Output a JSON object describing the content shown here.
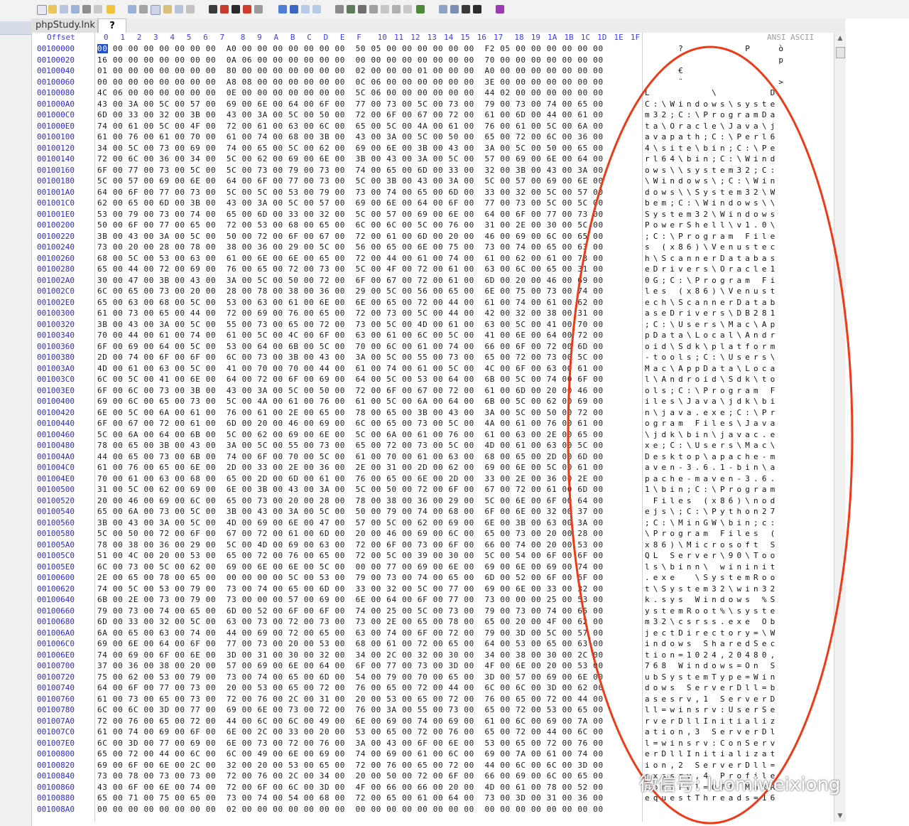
{
  "tabs": [
    "phpStudy.lnk",
    "?"
  ],
  "header": {
    "offset_label": "Offset",
    "columns": [
      "0",
      "1",
      "2",
      "3",
      "4",
      "5",
      "6",
      "7",
      "8",
      "9",
      "A",
      "B",
      "C",
      "D",
      "E",
      "F",
      "10",
      "11",
      "12",
      "13",
      "14",
      "15",
      "16",
      "17",
      "18",
      "19",
      "1A",
      "1B",
      "1C",
      "1D",
      "1E",
      "1F"
    ],
    "ascii_label": "ANSI ASCII"
  },
  "rows": [
    {
      "offset": "00100000",
      "hex": "00 00 00 00 00 00 00 00  A0 00 00 00 00 00 00 00  50 05 00 00 00 00 00 00  F2 05 00 00 00 00 00 00",
      "ascii": "    ?       P   ò   "
    },
    {
      "offset": "00100020",
      "hex": "16 00 00 00 00 00 00 00  0A 06 00 00 00 00 00 00  00 00 00 00 00 00 00 00  70 00 00 00 00 00 00 00",
      "ascii": "                p   "
    },
    {
      "offset": "00100040",
      "hex": "01 00 00 00 00 00 00 00  80 00 00 00 00 00 00 00  02 00 00 00 01 00 00 00  A0 00 00 00 00 00 00 00",
      "ascii": "    €               "
    },
    {
      "offset": "00100060",
      "hex": "00 00 00 00 00 00 00 00  A8 08 00 00 00 00 00 00  0C 06 00 00 00 00 00 00  3E 00 00 00 00 00 00 00",
      "ascii": "    ¨           >   "
    },
    {
      "offset": "00100080",
      "hex": "4C 06 00 00 00 00 00 00  0E 00 00 00 00 00 00 00  5C 06 00 00 00 00 00 00  44 02 00 00 00 00 00 00",
      "ascii": "L       \\      D    "
    },
    {
      "offset": "001000A0",
      "hex": "43 00 3A 00 5C 00 57 00  69 00 6E 00 64 00 6F 00  77 00 73 00 5C 00 73 00  79 00 73 00 74 00 65 00",
      "ascii": "C:\\Windows\\syste"
    },
    {
      "offset": "001000C0",
      "hex": "6D 00 33 00 32 00 3B 00  43 00 3A 00 5C 00 50 00  72 00 6F 00 67 00 72 00  61 00 6D 00 44 00 61 00",
      "ascii": "m32;C:\\ProgramDa"
    },
    {
      "offset": "001000E0",
      "hex": "74 00 61 00 5C 00 4F 00  72 00 61 00 63 00 6C 00  65 00 5C 00 4A 00 61 00  76 00 61 00 5C 00 6A 00",
      "ascii": "ta\\Oracle\\Java\\j"
    },
    {
      "offset": "00100100",
      "hex": "61 00 76 00 61 00 70 00  61 00 74 00 68 00 3B 00  43 00 3A 00 5C 00 50 00  65 00 72 00 6C 00 36 00",
      "ascii": "avapath;C:\\Perl6"
    },
    {
      "offset": "00100120",
      "hex": "34 00 5C 00 73 00 69 00  74 00 65 00 5C 00 62 00  69 00 6E 00 3B 00 43 00  3A 00 5C 00 50 00 65 00",
      "ascii": "4\\site\\bin;C:\\Pe"
    },
    {
      "offset": "00100140",
      "hex": "72 00 6C 00 36 00 34 00  5C 00 62 00 69 00 6E 00  3B 00 43 00 3A 00 5C 00  57 00 69 00 6E 00 64 00",
      "ascii": "rl64\\bin;C:\\Wind"
    },
    {
      "offset": "00100160",
      "hex": "6F 00 77 00 73 00 5C 00  5C 00 73 00 79 00 73 00  74 00 65 00 6D 00 33 00  32 00 3B 00 43 00 3A 00",
      "ascii": "ows\\\\system32;C:"
    },
    {
      "offset": "00100180",
      "hex": "5C 00 57 00 69 00 6E 00  64 00 6F 00 77 00 73 00  5C 00 3B 00 43 00 3A 00  5C 00 57 00 69 00 6E 00",
      "ascii": "\\Windows\\;C:\\Win"
    },
    {
      "offset": "001001A0",
      "hex": "64 00 6F 00 77 00 73 00  5C 00 5C 00 53 00 79 00  73 00 74 00 65 00 6D 00  33 00 32 00 5C 00 57 00",
      "ascii": "dows\\\\System32\\W"
    },
    {
      "offset": "001001C0",
      "hex": "62 00 65 00 6D 00 3B 00  43 00 3A 00 5C 00 57 00  69 00 6E 00 64 00 6F 00  77 00 73 00 5C 00 5C 00",
      "ascii": "bem;C:\\Windows\\\\"
    },
    {
      "offset": "001001E0",
      "hex": "53 00 79 00 73 00 74 00  65 00 6D 00 33 00 32 00  5C 00 57 00 69 00 6E 00  64 00 6F 00 77 00 73 00",
      "ascii": "System32\\Windows"
    },
    {
      "offset": "00100200",
      "hex": "50 00 6F 00 77 00 65 00  72 00 53 00 68 00 65 00  6C 00 6C 00 5C 00 76 00  31 00 2E 00 30 00 5C 00",
      "ascii": "PowerShell\\v1.0\\"
    },
    {
      "offset": "00100220",
      "hex": "3B 00 43 00 3A 00 5C 00  50 00 72 00 6F 00 67 00  72 00 61 00 6D 00 20 00  46 00 69 00 6C 00 65 00",
      "ascii": ";C:\\Program File"
    },
    {
      "offset": "00100240",
      "hex": "73 00 20 00 28 00 78 00  38 00 36 00 29 00 5C 00  56 00 65 00 6E 00 75 00  73 00 74 00 65 00 63 00",
      "ascii": "s (x86)\\Venustec"
    },
    {
      "offset": "00100260",
      "hex": "68 00 5C 00 53 00 63 00  61 00 6E 00 6E 00 65 00  72 00 44 00 61 00 74 00  61 00 62 00 61 00 73 00",
      "ascii": "h\\ScannerDatabas"
    },
    {
      "offset": "00100280",
      "hex": "65 00 44 00 72 00 69 00  76 00 65 00 72 00 73 00  5C 00 4F 00 72 00 61 00  63 00 6C 00 65 00 31 00",
      "ascii": "eDrivers\\Oracle1"
    },
    {
      "offset": "001002A0",
      "hex": "30 00 47 00 3B 00 43 00  3A 00 5C 00 50 00 72 00  6F 00 67 00 72 00 61 00  6D 00 20 00 46 00 69 00",
      "ascii": "0G;C:\\Program Fi"
    },
    {
      "offset": "001002C0",
      "hex": "6C 00 65 00 73 00 20 00  28 00 78 00 38 00 36 00  29 00 5C 00 56 00 65 00  6E 00 75 00 73 00 74 00",
      "ascii": "les (x86)\\Venust"
    },
    {
      "offset": "001002E0",
      "hex": "65 00 63 00 68 00 5C 00  53 00 63 00 61 00 6E 00  6E 00 65 00 72 00 44 00  61 00 74 00 61 00 62 00",
      "ascii": "ech\\ScannerDatab"
    },
    {
      "offset": "00100300",
      "hex": "61 00 73 00 65 00 44 00  72 00 69 00 76 00 65 00  72 00 73 00 5C 00 44 00  42 00 32 00 38 00 31 00",
      "ascii": "aseDrivers\\DB281"
    },
    {
      "offset": "00100320",
      "hex": "3B 00 43 00 3A 00 5C 00  55 00 73 00 65 00 72 00  73 00 5C 00 4D 00 61 00  63 00 5C 00 41 00 70 00",
      "ascii": ";C:\\Users\\Mac\\Ap"
    },
    {
      "offset": "00100340",
      "hex": "70 00 44 00 61 00 74 00  61 00 5C 00 4C 00 6F 00  63 00 61 00 6C 00 5C 00  41 00 6E 00 64 00 72 00",
      "ascii": "pData\\Local\\Andr"
    },
    {
      "offset": "00100360",
      "hex": "6F 00 69 00 64 00 5C 00  53 00 64 00 6B 00 5C 00  70 00 6C 00 61 00 74 00  66 00 6F 00 72 00 6D 00",
      "ascii": "oid\\Sdk\\platform"
    },
    {
      "offset": "00100380",
      "hex": "2D 00 74 00 6F 00 6F 00  6C 00 73 00 3B 00 43 00  3A 00 5C 00 55 00 73 00  65 00 72 00 73 00 5C 00",
      "ascii": "-tools;C:\\Users\\"
    },
    {
      "offset": "001003A0",
      "hex": "4D 00 61 00 63 00 5C 00  41 00 70 00 70 00 44 00  61 00 74 00 61 00 5C 00  4C 00 6F 00 63 00 61 00",
      "ascii": "Mac\\AppData\\Loca"
    },
    {
      "offset": "001003C0",
      "hex": "6C 00 5C 00 41 00 6E 00  64 00 72 00 6F 00 69 00  64 00 5C 00 53 00 64 00  6B 00 5C 00 74 00 6F 00",
      "ascii": "l\\Android\\Sdk\\to"
    },
    {
      "offset": "001003E0",
      "hex": "6F 00 6C 00 73 00 3B 00  43 00 3A 00 5C 00 50 00  72 00 6F 00 67 00 72 00  61 00 6D 00 20 00 46 00",
      "ascii": "ols;C:\\Program F"
    },
    {
      "offset": "00100400",
      "hex": "69 00 6C 00 65 00 73 00  5C 00 4A 00 61 00 76 00  61 00 5C 00 6A 00 64 00  6B 00 5C 00 62 00 69 00",
      "ascii": "iles\\Java\\jdk\\bi"
    },
    {
      "offset": "00100420",
      "hex": "6E 00 5C 00 6A 00 61 00  76 00 61 00 2E 00 65 00  78 00 65 00 3B 00 43 00  3A 00 5C 00 50 00 72 00",
      "ascii": "n\\java.exe;C:\\Pr"
    },
    {
      "offset": "00100440",
      "hex": "6F 00 67 00 72 00 61 00  6D 00 20 00 46 00 69 00  6C 00 65 00 73 00 5C 00  4A 00 61 00 76 00 61 00",
      "ascii": "ogram Files\\Java"
    },
    {
      "offset": "00100460",
      "hex": "5C 00 6A 00 64 00 6B 00  5C 00 62 00 69 00 6E 00  5C 00 6A 00 61 00 76 00  61 00 63 00 2E 00 65 00",
      "ascii": "\\jdk\\bin\\javac.e"
    },
    {
      "offset": "00100480",
      "hex": "78 00 65 00 3B 00 43 00  3A 00 5C 00 55 00 73 00  65 00 72 00 73 00 5C 00  4D 00 61 00 63 00 5C 00",
      "ascii": "xe;C:\\Users\\Mac\\"
    },
    {
      "offset": "001004A0",
      "hex": "44 00 65 00 73 00 6B 00  74 00 6F 00 70 00 5C 00  61 00 70 00 61 00 63 00  68 00 65 00 2D 00 6D 00",
      "ascii": "Desktop\\apache-m"
    },
    {
      "offset": "001004C0",
      "hex": "61 00 76 00 65 00 6E 00  2D 00 33 00 2E 00 36 00  2E 00 31 00 2D 00 62 00  69 00 6E 00 5C 00 61 00",
      "ascii": "aven-3.6.1-bin\\a"
    },
    {
      "offset": "001004E0",
      "hex": "70 00 61 00 63 00 68 00  65 00 2D 00 6D 00 61 00  76 00 65 00 6E 00 2D 00  33 00 2E 00 36 00 2E 00",
      "ascii": "pache-maven-3.6."
    },
    {
      "offset": "00100500",
      "hex": "31 00 5C 00 62 00 69 00  6E 00 3B 00 43 00 3A 00  5C 00 50 00 72 00 6F 00  67 00 72 00 61 00 6D 00",
      "ascii": "1\\bin;C:\\Program"
    },
    {
      "offset": "00100520",
      "hex": "20 00 46 00 69 00 6C 00  65 00 73 00 20 00 28 00  78 00 38 00 36 00 29 00  5C 00 6E 00 6F 00 64 00",
      "ascii": " Files (x86)\\nod"
    },
    {
      "offset": "00100540",
      "hex": "65 00 6A 00 73 00 5C 00  3B 00 43 00 3A 00 5C 00  50 00 79 00 74 00 68 00  6F 00 6E 00 32 00 37 00",
      "ascii": "ejs\\;C:\\Python27"
    },
    {
      "offset": "00100560",
      "hex": "3B 00 43 00 3A 00 5C 00  4D 00 69 00 6E 00 47 00  57 00 5C 00 62 00 69 00  6E 00 3B 00 63 00 3A 00",
      "ascii": ";C:\\MinGW\\bin;c:"
    },
    {
      "offset": "00100580",
      "hex": "5C 00 50 00 72 00 6F 00  67 00 72 00 61 00 6D 00  20 00 46 00 69 00 6C 00  65 00 73 00 20 00 28 00",
      "ascii": "\\Program Files ("
    },
    {
      "offset": "001005A0",
      "hex": "78 00 38 00 36 00 29 00  5C 00 4D 00 69 00 63 00  72 00 6F 00 73 00 6F 00  66 00 74 00 20 00 53 00",
      "ascii": "x86)\\Microsoft S"
    },
    {
      "offset": "001005C0",
      "hex": "51 00 4C 00 20 00 53 00  65 00 72 00 76 00 65 00  72 00 5C 00 39 00 30 00  5C 00 54 00 6F 00 6F 00",
      "ascii": "QL Server\\90\\Too"
    },
    {
      "offset": "001005E0",
      "hex": "6C 00 73 00 5C 00 62 00  69 00 6E 00 6E 00 5C 00  00 00 77 00 69 00 6E 00  69 00 6E 00 69 00 74 00",
      "ascii": "ls\\binn\\ wininit"
    },
    {
      "offset": "00100600",
      "hex": "2E 00 65 00 78 00 65 00  00 00 00 00 5C 00 53 00  79 00 73 00 74 00 65 00  6D 00 52 00 6F 00 6F 00",
      "ascii": ".exe  \\SystemRoo"
    },
    {
      "offset": "00100620",
      "hex": "74 00 5C 00 53 00 79 00  73 00 74 00 65 00 6D 00  33 00 32 00 5C 00 77 00  69 00 6E 00 33 00 32 00",
      "ascii": "t\\System32\\win32"
    },
    {
      "offset": "00100640",
      "hex": "6B 00 2E 00 73 00 79 00  73 00 00 00 57 00 69 00  6E 00 64 00 6F 00 77 00  73 00 00 00 25 00 53 00",
      "ascii": "k.sys Windows %S"
    },
    {
      "offset": "00100660",
      "hex": "79 00 73 00 74 00 65 00  6D 00 52 00 6F 00 6F 00  74 00 25 00 5C 00 73 00  79 00 73 00 74 00 65 00",
      "ascii": "ystemRoot%\\syste"
    },
    {
      "offset": "00100680",
      "hex": "6D 00 33 00 32 00 5C 00  63 00 73 00 72 00 73 00  73 00 2E 00 65 00 78 00  65 00 20 00 4F 00 62 00",
      "ascii": "m32\\csrss.exe Ob"
    },
    {
      "offset": "001006A0",
      "hex": "6A 00 65 00 63 00 74 00  44 00 69 00 72 00 65 00  63 00 74 00 6F 00 72 00  79 00 3D 00 5C 00 57 00",
      "ascii": "jectDirectory=\\W"
    },
    {
      "offset": "001006C0",
      "hex": "69 00 6E 00 64 00 6F 00  77 00 73 00 20 00 53 00  68 00 61 00 72 00 65 00  64 00 53 00 65 00 63 00",
      "ascii": "indows SharedSec"
    },
    {
      "offset": "001006E0",
      "hex": "74 00 69 00 6F 00 6E 00  3D 00 31 00 30 00 32 00  34 00 2C 00 32 00 30 00  34 00 38 00 30 00 2C 00",
      "ascii": "tion=1024,20480,"
    },
    {
      "offset": "00100700",
      "hex": "37 00 36 00 38 00 20 00  57 00 69 00 6E 00 64 00  6F 00 77 00 73 00 3D 00  4F 00 6E 00 20 00 53 00",
      "ascii": "768 Windows=On S"
    },
    {
      "offset": "00100720",
      "hex": "75 00 62 00 53 00 79 00  73 00 74 00 65 00 6D 00  54 00 79 00 70 00 65 00  3D 00 57 00 69 00 6E 00",
      "ascii": "ubSystemType=Win"
    },
    {
      "offset": "00100740",
      "hex": "64 00 6F 00 77 00 73 00  20 00 53 00 65 00 72 00  76 00 65 00 72 00 44 00  6C 00 6C 00 3D 00 62 00",
      "ascii": "dows ServerDll=b"
    },
    {
      "offset": "00100760",
      "hex": "61 00 73 00 65 00 73 00  72 00 76 00 2C 00 31 00  20 00 53 00 65 00 72 00  76 00 65 00 72 00 44 00",
      "ascii": "asesrv,1 ServerD"
    },
    {
      "offset": "00100780",
      "hex": "6C 00 6C 00 3D 00 77 00  69 00 6E 00 73 00 72 00  76 00 3A 00 55 00 73 00  65 00 72 00 53 00 65 00",
      "ascii": "ll=winsrv:UserSe"
    },
    {
      "offset": "001007A0",
      "hex": "72 00 76 00 65 00 72 00  44 00 6C 00 6C 00 49 00  6E 00 69 00 74 00 69 00  61 00 6C 00 69 00 7A 00",
      "ascii": "rverDllInitializ"
    },
    {
      "offset": "001007C0",
      "hex": "61 00 74 00 69 00 6F 00  6E 00 2C 00 33 00 20 00  53 00 65 00 72 00 76 00  65 00 72 00 44 00 6C 00",
      "ascii": "ation,3 ServerDl"
    },
    {
      "offset": "001007E0",
      "hex": "6C 00 3D 00 77 00 69 00  6E 00 73 00 72 00 76 00  3A 00 43 00 6F 00 6E 00  53 00 65 00 72 00 76 00",
      "ascii": "l=winsrv:ConServ"
    },
    {
      "offset": "00100800",
      "hex": "65 00 72 00 44 00 6C 00  6C 00 49 00 6E 00 69 00  74 00 69 00 61 00 6C 00  69 00 7A 00 61 00 74 00",
      "ascii": "erDllInitializat"
    },
    {
      "offset": "00100820",
      "hex": "69 00 6F 00 6E 00 2C 00  32 00 20 00 53 00 65 00  72 00 76 00 65 00 72 00  44 00 6C 00 6C 00 3D 00",
      "ascii": "ion,2 ServerDll="
    },
    {
      "offset": "00100840",
      "hex": "73 00 78 00 73 00 73 00  72 00 76 00 2C 00 34 00  20 00 50 00 72 00 6F 00  66 00 69 00 6C 00 65 00",
      "ascii": "sxssrv,4 Profile"
    },
    {
      "offset": "00100860",
      "hex": "43 00 6F 00 6E 00 74 00  72 00 6F 00 6C 00 3D 00  4F 00 66 00 66 00 20 00  4D 00 61 00 78 00 52 00",
      "ascii": "Control=Off MaxR"
    },
    {
      "offset": "00100880",
      "hex": "65 00 71 00 75 00 65 00  73 00 74 00 54 00 68 00  72 00 65 00 61 00 64 00  73 00 3D 00 31 00 36 00",
      "ascii": "equestThreads=16"
    },
    {
      "offset": "001008A0",
      "hex": "00 00 00 00 00 00 00 00  02 00 00 00 00 00 00 00  00 00 00 00 00 00 00 00  00 00 00 00 00 00 00 00",
      "ascii": "                "
    }
  ],
  "watermark": {
    "text": "微信号: luomiweixiong"
  },
  "colors": {
    "offset_blue": "#2a2ad8",
    "header_blue": "#3d3df0",
    "annotation_red": "#ee3a17",
    "cursor_blue": "#1f4fd0"
  }
}
